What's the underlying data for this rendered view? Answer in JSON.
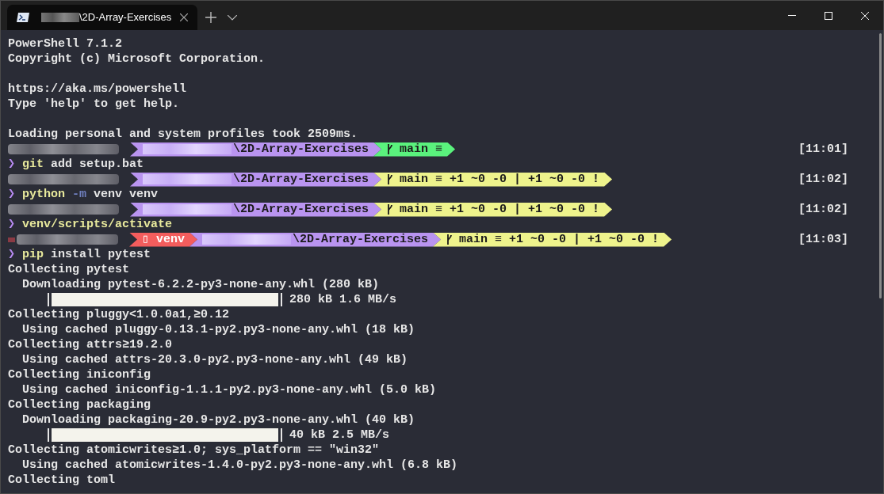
{
  "tab": {
    "title": "\\2D-Array-Exercises",
    "selected": true
  },
  "lines": [
    {
      "kind": "text",
      "text": "PowerShell 7.1.2"
    },
    {
      "kind": "text",
      "text": "Copyright (c) Microsoft Corporation."
    },
    {
      "kind": "blank"
    },
    {
      "kind": "text",
      "text": "https://aka.ms/powershell"
    },
    {
      "kind": "text",
      "text": "Type 'help' to get help."
    },
    {
      "kind": "blank"
    },
    {
      "kind": "text",
      "text": "Loading personal and system profiles took 2509ms."
    },
    {
      "kind": "prompt",
      "marker": false,
      "time": "[11:01]",
      "segments": [
        {
          "kind": "path",
          "text": "\\2D-Array-Exercises",
          "color": "#b994f0"
        },
        {
          "kind": "git",
          "text": "main ≡",
          "color": "#5af27d"
        }
      ]
    },
    {
      "kind": "command",
      "prompt": "❯",
      "parts": [
        {
          "kind": "program",
          "text": "git"
        },
        {
          "kind": "arg",
          "text": "add setup.bat"
        }
      ]
    },
    {
      "kind": "prompt",
      "marker": false,
      "time": "[11:02]",
      "segments": [
        {
          "kind": "path",
          "text": "\\2D-Array-Exercises",
          "color": "#b994f0"
        },
        {
          "kind": "git",
          "text": "main ≡ +1 ~0 -0 | +1 ~0 -0 !",
          "color": "#eef38c"
        }
      ]
    },
    {
      "kind": "command",
      "prompt": "❯",
      "parts": [
        {
          "kind": "program",
          "text": "python"
        },
        {
          "kind": "flag",
          "text": "-m"
        },
        {
          "kind": "arg",
          "text": "venv venv"
        }
      ]
    },
    {
      "kind": "prompt",
      "marker": false,
      "time": "[11:02]",
      "segments": [
        {
          "kind": "path",
          "text": "\\2D-Array-Exercises",
          "color": "#b994f0"
        },
        {
          "kind": "git",
          "text": "main ≡ +1 ~0 -0 | +1 ~0 -0 !",
          "color": "#eef38c"
        }
      ]
    },
    {
      "kind": "command",
      "prompt": "❯",
      "parts": [
        {
          "kind": "program",
          "text": "venv/scripts/activate"
        }
      ]
    },
    {
      "kind": "prompt",
      "marker": true,
      "time": "[11:03]",
      "segments": [
        {
          "kind": "venv",
          "text": "▯ venv",
          "color": "#f45d5d"
        },
        {
          "kind": "path",
          "text": "\\2D-Array-Exercises",
          "color": "#b994f0"
        },
        {
          "kind": "git",
          "text": "main ≡ +1 ~0 -0 | +1 ~0 -0 !",
          "color": "#eef38c"
        }
      ]
    },
    {
      "kind": "command",
      "prompt": "❯",
      "parts": [
        {
          "kind": "program",
          "text": "pip"
        },
        {
          "kind": "arg",
          "text": "install pytest"
        }
      ]
    },
    {
      "kind": "text",
      "text": "Collecting pytest"
    },
    {
      "kind": "text",
      "text": "  Downloading pytest-6.2.2-py3-none-any.whl (280 kB)"
    },
    {
      "kind": "progress",
      "level": 1,
      "reading": "280 kB 1.6 MB/s"
    },
    {
      "kind": "text",
      "text": "Collecting pluggy<1.0.0a1,≥0.12"
    },
    {
      "kind": "text",
      "text": "  Using cached pluggy-0.13.1-py2.py3-none-any.whl (18 kB)"
    },
    {
      "kind": "text",
      "text": "Collecting attrs≥19.2.0"
    },
    {
      "kind": "text",
      "text": "  Using cached attrs-20.3.0-py2.py3-none-any.whl (49 kB)"
    },
    {
      "kind": "text",
      "text": "Collecting iniconfig"
    },
    {
      "kind": "text",
      "text": "  Using cached iniconfig-1.1.1-py2.py3-none-any.whl (5.0 kB)"
    },
    {
      "kind": "text",
      "text": "Collecting packaging"
    },
    {
      "kind": "text",
      "text": "  Downloading packaging-20.9-py2.py3-none-any.whl (40 kB)"
    },
    {
      "kind": "progress",
      "level": 1,
      "reading": "40 kB 2.5 MB/s"
    },
    {
      "kind": "text",
      "text": "Collecting atomicwrites≥1.0; sys_platform == \"win32\""
    },
    {
      "kind": "text",
      "text": "  Using cached atomicwrites-1.4.0-py2.py3-none-any.whl (6.8 kB)"
    },
    {
      "kind": "text",
      "text": "Collecting toml"
    }
  ]
}
